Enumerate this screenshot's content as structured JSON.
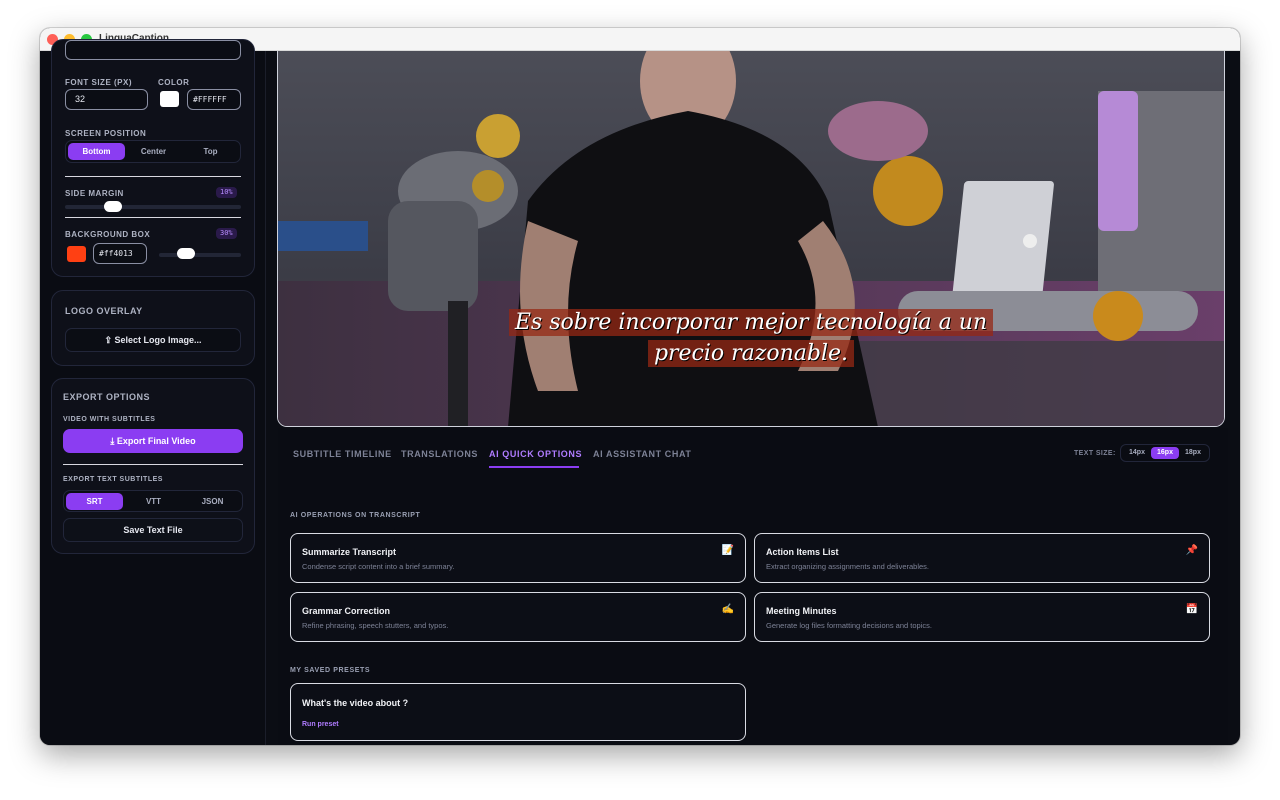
{
  "window": {
    "title": "LinguaCaption"
  },
  "sidebar": {
    "font_size_label": "FONT SIZE (PX)",
    "font_size_value": "32",
    "color_label": "COLOR",
    "color_value": "#FFFFFF",
    "screen_position_label": "SCREEN POSITION",
    "positions": [
      "Bottom",
      "Center",
      "Top"
    ],
    "selected_position": "Bottom",
    "side_margin_label": "SIDE MARGIN",
    "side_margin_value": "10%",
    "side_margin_fraction": 0.3,
    "background_box_label": "BACKGROUND BOX",
    "background_box_value": "30%",
    "background_color": "#ff4013",
    "background_color_text": "#ff4013",
    "background_opacity_fraction": 0.3,
    "logo_overlay_title": "LOGO OVERLAY",
    "select_logo_label": "Select Logo Image...",
    "export_title": "EXPORT OPTIONS",
    "video_with_subtitles_label": "VIDEO WITH SUBTITLES",
    "export_video_label": "Export Final Video",
    "export_text_label": "EXPORT TEXT SUBTITLES",
    "formats": [
      "SRT",
      "VTT",
      "JSON"
    ],
    "selected_format": "SRT",
    "save_text_label": "Save Text File"
  },
  "video": {
    "subtitle_line1": "Es sobre incorporar mejor tecnología a un",
    "subtitle_line2": "precio razonable."
  },
  "tabs": [
    "SUBTITLE TIMELINE",
    "TRANSLATIONS",
    "AI QUICK OPTIONS",
    "AI ASSISTANT CHAT"
  ],
  "active_tab": "AI QUICK OPTIONS",
  "text_size": {
    "label": "TEXT SIZE:",
    "options": [
      "14px",
      "16px",
      "18px"
    ],
    "selected": "16px"
  },
  "ai_ops": {
    "title": "AI OPERATIONS ON TRANSCRIPT",
    "cards": [
      {
        "title": "Summarize Transcript",
        "desc": "Condense script content into a brief summary.",
        "icon": "memo-icon",
        "glyph": "📝"
      },
      {
        "title": "Action Items List",
        "desc": "Extract organizing assignments and deliverables.",
        "icon": "pin-icon",
        "glyph": "📌"
      },
      {
        "title": "Grammar Correction",
        "desc": "Refine phrasing, speech stutters, and typos.",
        "icon": "writing-hand-icon",
        "glyph": "✍️"
      },
      {
        "title": "Meeting Minutes",
        "desc": "Generate log files formatting decisions and topics.",
        "icon": "calendar-icon",
        "glyph": "📅"
      }
    ]
  },
  "presets": {
    "title": "MY SAVED PRESETS",
    "items": [
      {
        "title": "What's the video about ?",
        "action": "Run preset"
      }
    ]
  },
  "colors": {
    "accent": "#8b3df2",
    "accent_text": "#b07cff",
    "background": "#0b0d14"
  }
}
